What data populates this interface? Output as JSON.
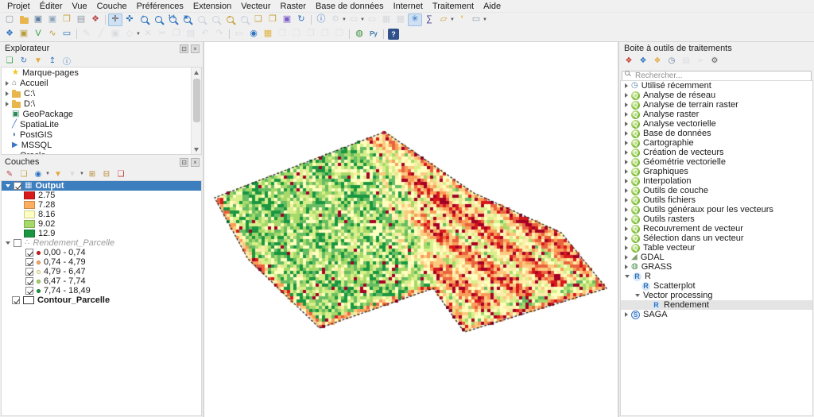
{
  "menu_items": [
    "Projet",
    "Éditer",
    "Vue",
    "Couche",
    "Préférences",
    "Extension",
    "Vecteur",
    "Raster",
    "Base de données",
    "Internet",
    "Traitement",
    "Aide"
  ],
  "toolbar1": [
    {
      "name": "new-project",
      "glyph": "▢",
      "color": "#8d9aa5"
    },
    {
      "name": "open-project",
      "icon": "folder"
    },
    {
      "name": "save-project",
      "glyph": "▣",
      "color": "#5f7f9e"
    },
    {
      "name": "save-project-as",
      "glyph": "▣",
      "color": "#8fa6bb"
    },
    {
      "name": "new-from-template",
      "glyph": "❐",
      "color": "#c9a23f"
    },
    {
      "name": "new-print-layout",
      "glyph": "▤",
      "color": "#8d9aa5"
    },
    {
      "name": "style-manager",
      "glyph": "❖",
      "color": "#b5484d"
    },
    {
      "sep": true
    },
    {
      "name": "pan-map",
      "glyph": "✛",
      "color": "#4a4a4a",
      "active": true
    },
    {
      "name": "pan-to-selection",
      "glyph": "✜",
      "color": "#2f74c0"
    },
    {
      "name": "zoom-in",
      "mag": "+",
      "color": "#2f74c0"
    },
    {
      "name": "zoom-out",
      "mag": "−",
      "color": "#2f74c0"
    },
    {
      "name": "zoom-native",
      "mag": "1:1",
      "color": "#2f74c0"
    },
    {
      "name": "zoom-full",
      "mag": "▣",
      "color": "#2f74c0"
    },
    {
      "name": "zoom-to-selection",
      "mag": "",
      "color": "#90a4b8",
      "disabled": true
    },
    {
      "name": "zoom-to-layer",
      "mag": "",
      "color": "#90a4b8",
      "disabled": true
    },
    {
      "name": "zoom-last",
      "mag": "◂",
      "color": "#c9a23f"
    },
    {
      "name": "zoom-next",
      "mag": "▸",
      "color": "#90a4b8",
      "disabled": true
    },
    {
      "name": "new-spatial-bookmark",
      "glyph": "❑",
      "color": "#c9a23f"
    },
    {
      "name": "show-bookmarks",
      "glyph": "❒",
      "color": "#c9a23f"
    },
    {
      "name": "temporal-controller",
      "glyph": "▣",
      "color": "#7b5ec7"
    },
    {
      "name": "refresh-map",
      "glyph": "↻",
      "color": "#2f74c0"
    },
    {
      "sep": true
    },
    {
      "name": "identify-features",
      "glyph": "ⓘ",
      "color": "#2f74c0"
    },
    {
      "name": "run-feature-action",
      "glyph": "⚙",
      "color": "#aab4bd",
      "disabled": true,
      "dd": true
    },
    {
      "name": "select-features",
      "glyph": "▭",
      "color": "#aab4bd",
      "disabled": true,
      "dd": true
    },
    {
      "name": "deselect-features",
      "glyph": "▭",
      "color": "#aab4bd",
      "disabled": true
    },
    {
      "name": "open-attribute-table",
      "glyph": "▦",
      "color": "#aab4bd",
      "disabled": true
    },
    {
      "name": "field-calculator",
      "glyph": "▦",
      "color": "#aab4bd",
      "disabled": true
    },
    {
      "name": "processing-toolbox-toggle",
      "glyph": "✳",
      "color": "#2f74c0",
      "active": true
    },
    {
      "name": "statistics-summary",
      "glyph": "∑",
      "color": "#463a8c"
    },
    {
      "name": "measure",
      "glyph": "▱",
      "color": "#c9a23f",
      "dd": true
    },
    {
      "name": "map-tips",
      "glyph": "❛",
      "color": "#e9bd4a"
    },
    {
      "name": "text-annotation",
      "glyph": "▭",
      "color": "#8d9aa5",
      "dd": true
    }
  ],
  "toolbar2": [
    {
      "name": "data-source-manager",
      "glyph": "❖",
      "color": "#2f74c0"
    },
    {
      "name": "new-geopackage-layer",
      "glyph": "▣",
      "color": "#b89b3c"
    },
    {
      "name": "new-shapefile-layer",
      "glyph": "V",
      "color": "#2f9e44"
    },
    {
      "name": "new-spatialite-layer",
      "glyph": "∿",
      "color": "#b89b3c"
    },
    {
      "name": "new-virtual-layer",
      "glyph": "▭",
      "color": "#2f74c0"
    },
    {
      "sep": true
    },
    {
      "name": "toggle-editing",
      "glyph": "✎",
      "color": "#b6bdc4",
      "disabled": true
    },
    {
      "name": "add-feature",
      "glyph": "╱",
      "color": "#b6bdc4",
      "disabled": true
    },
    {
      "name": "save-layer-edits",
      "glyph": "▣",
      "color": "#b6bdc4",
      "disabled": true
    },
    {
      "name": "vertex-tool",
      "glyph": "◇",
      "color": "#b6bdc4",
      "disabled": true,
      "dd": true
    },
    {
      "name": "delete-selected",
      "glyph": "✕",
      "color": "#b6bdc4",
      "disabled": true
    },
    {
      "name": "cut-features",
      "glyph": "✂",
      "color": "#b6bdc4",
      "disabled": true
    },
    {
      "name": "copy-features",
      "glyph": "❐",
      "color": "#b6bdc4",
      "disabled": true
    },
    {
      "name": "paste-features",
      "glyph": "▤",
      "color": "#b6bdc4",
      "disabled": true
    },
    {
      "name": "undo",
      "glyph": "↶",
      "color": "#b6bdc4",
      "disabled": true
    },
    {
      "name": "redo",
      "glyph": "↷",
      "color": "#b6bdc4",
      "disabled": true
    },
    {
      "sep": true
    },
    {
      "name": "snapping-options",
      "glyph": "▭",
      "color": "#b6bdc4",
      "disabled": true
    },
    {
      "name": "snapping-magnet",
      "glyph": "◉",
      "color": "#2f74c0"
    },
    {
      "name": "snapping-grid",
      "glyph": "▦",
      "color": "#e0b23f"
    },
    {
      "name": "topology-check-1",
      "glyph": "❐",
      "color": "#c9ccd0",
      "disabled": true
    },
    {
      "name": "topology-check-2",
      "glyph": "❐",
      "color": "#c9ccd0",
      "disabled": true
    },
    {
      "name": "topology-check-3",
      "glyph": "❐",
      "color": "#c9ccd0",
      "disabled": true
    },
    {
      "name": "topology-check-4",
      "glyph": "❐",
      "color": "#c9ccd0",
      "disabled": true
    },
    {
      "name": "topology-check-5",
      "glyph": "❐",
      "color": "#c9ccd0",
      "disabled": true
    },
    {
      "sep": true
    },
    {
      "name": "grass-tools",
      "glyph": "◍",
      "color": "#3e8e41"
    },
    {
      "name": "python-console",
      "glyph": "Py",
      "color": "#3776ab"
    },
    {
      "sep": true
    },
    {
      "name": "help",
      "glyph": "?",
      "help": true
    }
  ],
  "browser": {
    "title": "Explorateur",
    "tools": [
      {
        "name": "add-selected-layers",
        "glyph": "❏",
        "color": "#2f9e44"
      },
      {
        "name": "refresh-browser",
        "glyph": "↻",
        "color": "#2f74c0"
      },
      {
        "name": "filter-browser",
        "glyph": "▼",
        "color": "#e0a93f"
      },
      {
        "name": "collapse-all",
        "glyph": "↥",
        "color": "#2f74c0"
      },
      {
        "name": "enable-properties-widget",
        "glyph": "ⓘ",
        "color": "#2f74c0"
      }
    ],
    "items": [
      {
        "icon": "star",
        "label": "Marque-pages"
      },
      {
        "icon": "home",
        "label": "Accueil",
        "expandable": true
      },
      {
        "icon": "folder",
        "label": "C:\\",
        "expandable": true
      },
      {
        "icon": "folder",
        "label": "D:\\",
        "expandable": true
      },
      {
        "icon": "geopackage",
        "label": "GeoPackage"
      },
      {
        "icon": "spatialite",
        "label": "SpatiaLite"
      },
      {
        "icon": "postgis",
        "label": "PostGIS"
      },
      {
        "icon": "mssql",
        "label": "MSSQL"
      },
      {
        "icon": "oracle",
        "label": "Oracle"
      }
    ]
  },
  "layers": {
    "title": "Couches",
    "tools": [
      {
        "name": "open-layer-styling",
        "glyph": "✎",
        "color": "#b5484d"
      },
      {
        "name": "add-group",
        "glyph": "❏",
        "color": "#c9a23f"
      },
      {
        "name": "manage-map-themes",
        "glyph": "◉",
        "color": "#2f74c0",
        "dd": true
      },
      {
        "name": "filter-legend",
        "glyph": "▼",
        "color": "#e0a93f"
      },
      {
        "name": "filter-by-expression",
        "glyph": "▼",
        "color": "#b6bdc4",
        "disabled": true,
        "dd": true
      },
      {
        "name": "expand-all",
        "glyph": "⊞",
        "color": "#b8862f"
      },
      {
        "name": "collapse-all-layers",
        "glyph": "⊟",
        "color": "#b8862f"
      },
      {
        "name": "remove-layer",
        "glyph": "❑",
        "color": "#c0392b"
      }
    ],
    "tree": [
      {
        "type": "raster",
        "label": "Output",
        "checked": true,
        "selected": true,
        "expanded": true,
        "classes": [
          {
            "swatch": "#d7191c",
            "label": "2.75"
          },
          {
            "swatch": "#fdae61",
            "label": "7.28"
          },
          {
            "swatch": "#ffffc0",
            "label": "8.16"
          },
          {
            "swatch": "#a6d96a",
            "label": "9.02"
          },
          {
            "swatch": "#1a9641",
            "label": "12.9"
          }
        ]
      },
      {
        "type": "point",
        "label": "Rendement_Parcelle",
        "checked": false,
        "italic": true,
        "expanded": true,
        "classes": [
          {
            "dot": "#d7191c",
            "label": "0,00 - 0,74",
            "checked": true
          },
          {
            "dot": "#fdae61",
            "label": "0,74 - 4,79",
            "checked": true
          },
          {
            "dot": "#ffffbf",
            "label": "4,79 - 6,47",
            "checked": true
          },
          {
            "dot": "#a6d96a",
            "label": "6,47 - 7,74",
            "checked": true
          },
          {
            "dot": "#1a9641",
            "label": "7,74 - 18,49",
            "checked": true
          }
        ]
      },
      {
        "type": "polygon-outline",
        "label": "Contour_Parcelle",
        "checked": true,
        "bold": true
      }
    ]
  },
  "toolbox": {
    "title": "Boite à outils de traitements",
    "tools": [
      {
        "name": "models",
        "glyph": "❖",
        "color": "#c0392b"
      },
      {
        "name": "scripts",
        "glyph": "❖",
        "color": "#2f74c0"
      },
      {
        "name": "r-scripts",
        "glyph": "❖",
        "color": "#e0a93f"
      },
      {
        "name": "history",
        "glyph": "◷",
        "color": "#607d9e"
      },
      {
        "name": "results-viewer",
        "glyph": "▤",
        "color": "#b6bdc4",
        "disabled": true
      },
      {
        "name": "edit-features-in-place",
        "glyph": "➢",
        "color": "#b6bdc4",
        "disabled": true
      },
      {
        "name": "options",
        "glyph": "⚙",
        "color": "#5a5a5a"
      }
    ],
    "search_placeholder": "Rechercher...",
    "items": [
      {
        "icon": "clock",
        "label": "Utilisé récemment",
        "expander": "right"
      },
      {
        "icon": "q",
        "label": "Analyse de réseau",
        "expander": "right"
      },
      {
        "icon": "q",
        "label": "Analyse de terrain raster",
        "expander": "right"
      },
      {
        "icon": "q",
        "label": "Analyse raster",
        "expander": "right"
      },
      {
        "icon": "q",
        "label": "Analyse vectorielle",
        "expander": "right"
      },
      {
        "icon": "q",
        "label": "Base de données",
        "expander": "right"
      },
      {
        "icon": "q",
        "label": "Cartographie",
        "expander": "right"
      },
      {
        "icon": "q",
        "label": "Création de vecteurs",
        "expander": "right"
      },
      {
        "icon": "q",
        "label": "Géométrie vectorielle",
        "expander": "right"
      },
      {
        "icon": "q",
        "label": "Graphiques",
        "expander": "right"
      },
      {
        "icon": "q",
        "label": "Interpolation",
        "expander": "right"
      },
      {
        "icon": "q",
        "label": "Outils de couche",
        "expander": "right"
      },
      {
        "icon": "q",
        "label": "Outils fichiers",
        "expander": "right"
      },
      {
        "icon": "q",
        "label": "Outils généraux pour les vecteurs",
        "expander": "right"
      },
      {
        "icon": "q",
        "label": "Outils rasters",
        "expander": "right"
      },
      {
        "icon": "q",
        "label": "Recouvrement de vecteur",
        "expander": "right"
      },
      {
        "icon": "q",
        "label": "Sélection dans un vecteur",
        "expander": "right"
      },
      {
        "icon": "q",
        "label": "Table vecteur",
        "expander": "right"
      },
      {
        "icon": "gdal",
        "label": "GDAL",
        "expander": "right"
      },
      {
        "icon": "grass",
        "label": "GRASS",
        "expander": "right"
      },
      {
        "icon": "r",
        "label": "R",
        "expander": "down"
      },
      {
        "icon": "r",
        "label": "Scatterplot",
        "indent": 1,
        "expander": "none"
      },
      {
        "icon": "none",
        "label": "Vector processing",
        "indent": 1,
        "expander": "down"
      },
      {
        "icon": "r",
        "label": "Rendement",
        "indent": 2,
        "expander": "none",
        "selected": true
      },
      {
        "icon": "saga",
        "label": "SAGA",
        "expander": "right"
      }
    ]
  },
  "map": {
    "background": "#ffffff",
    "outline_color": "#141414",
    "raster_palette": [
      "#a50026",
      "#d7191c",
      "#ea633e",
      "#f99e59",
      "#fdc980",
      "#ffedaa",
      "#ffffbf",
      "#d9ef8b",
      "#a6d96a",
      "#66bd63",
      "#1a9641"
    ]
  }
}
